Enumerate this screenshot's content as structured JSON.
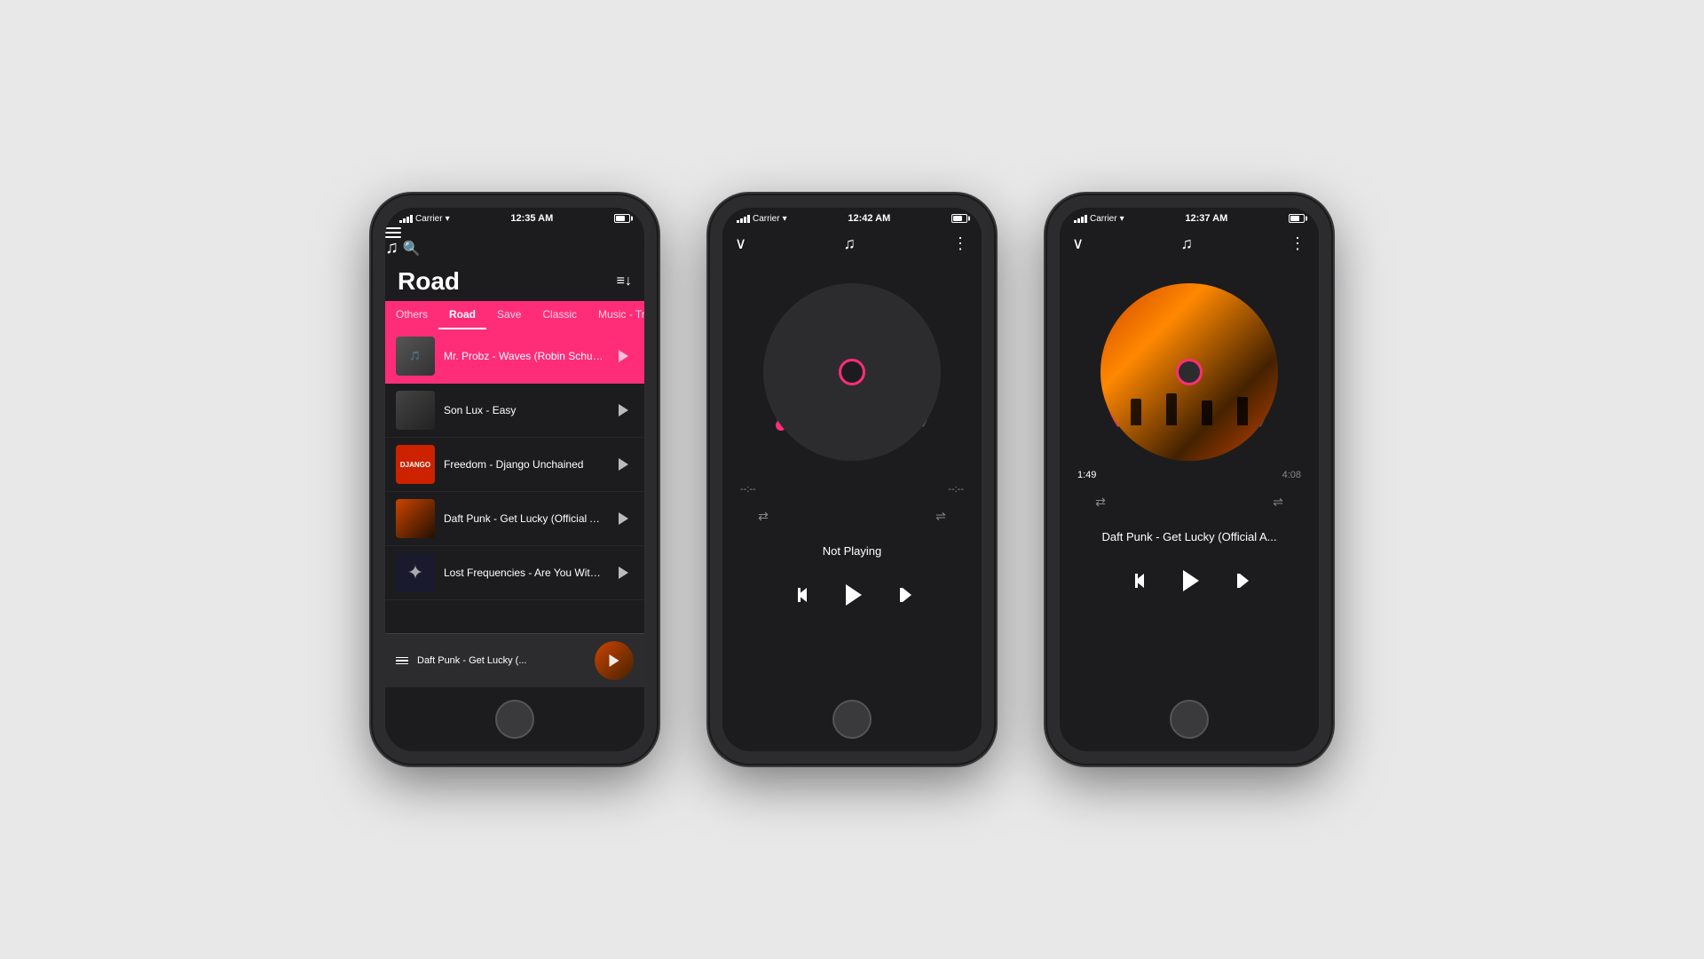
{
  "background": "#e8e8e8",
  "phone1": {
    "status": {
      "carrier": "Carrier",
      "time": "12:35 AM"
    },
    "nav": {
      "music_note": "♫"
    },
    "playlist_title": "Road",
    "categories": [
      "Others",
      "Road",
      "Save",
      "Classic",
      "Music - Trap"
    ],
    "active_category": "Road",
    "songs": [
      {
        "title": "Mr. Probz - Waves (Robin Schulz Remix Radio Edit)",
        "thumb_type": "waves",
        "active": true
      },
      {
        "title": "Son Lux - Easy",
        "thumb_type": "sonlux",
        "active": false
      },
      {
        "title": "Freedom - Django Unchained",
        "thumb_type": "django",
        "active": false
      },
      {
        "title": "Daft Punk - Get Lucky (Official Audio) ft. Pharrell Wil",
        "thumb_type": "daft",
        "active": false
      },
      {
        "title": "Lost Frequencies - Are You With Me (Official Music Video",
        "thumb_type": "lost",
        "active": false
      }
    ],
    "mini_player": {
      "title": "Daft Punk - Get Lucky (..."
    }
  },
  "phone2": {
    "status": {
      "carrier": "Carrier",
      "time": "12:42 AM"
    },
    "nav": {
      "music_note": "♫"
    },
    "time_left": "--:--",
    "time_right": "--:--",
    "track_title": "Not Playing",
    "playback": {
      "prev": "⏮",
      "play": "▶",
      "next": "⏭"
    }
  },
  "phone3": {
    "status": {
      "carrier": "Carrier",
      "time": "12:37 AM"
    },
    "nav": {
      "music_note": "♫"
    },
    "time_left": "1:49",
    "time_right": "4:08",
    "track_title": "Daft Punk - Get Lucky (Official A...",
    "playback": {
      "prev": "⏮",
      "play": "▶",
      "next": "⏭"
    }
  }
}
